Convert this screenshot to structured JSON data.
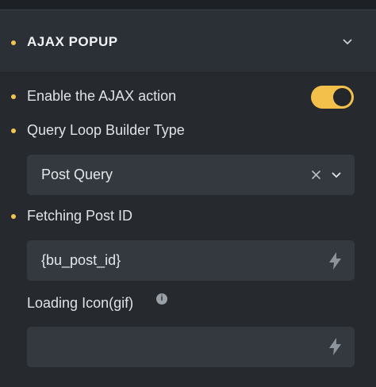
{
  "section": {
    "title": "AJAX POPUP"
  },
  "enable_ajax": {
    "label": "Enable the AJAX action",
    "enabled": true,
    "accent_color": "#f3c04c"
  },
  "query_loop": {
    "label": "Query Loop Builder Type",
    "selected": "Post Query"
  },
  "fetching_post_id": {
    "label": "Fetching Post ID",
    "value": "{bu_post_id}"
  },
  "loading_icon": {
    "label": "Loading Icon(gif)",
    "value": ""
  },
  "icons": {
    "collapse": "chevron-down-icon",
    "clear": "close-icon",
    "dropdown": "chevron-down-icon",
    "dynamic_data": "bolt-icon",
    "info": "info-icon"
  }
}
